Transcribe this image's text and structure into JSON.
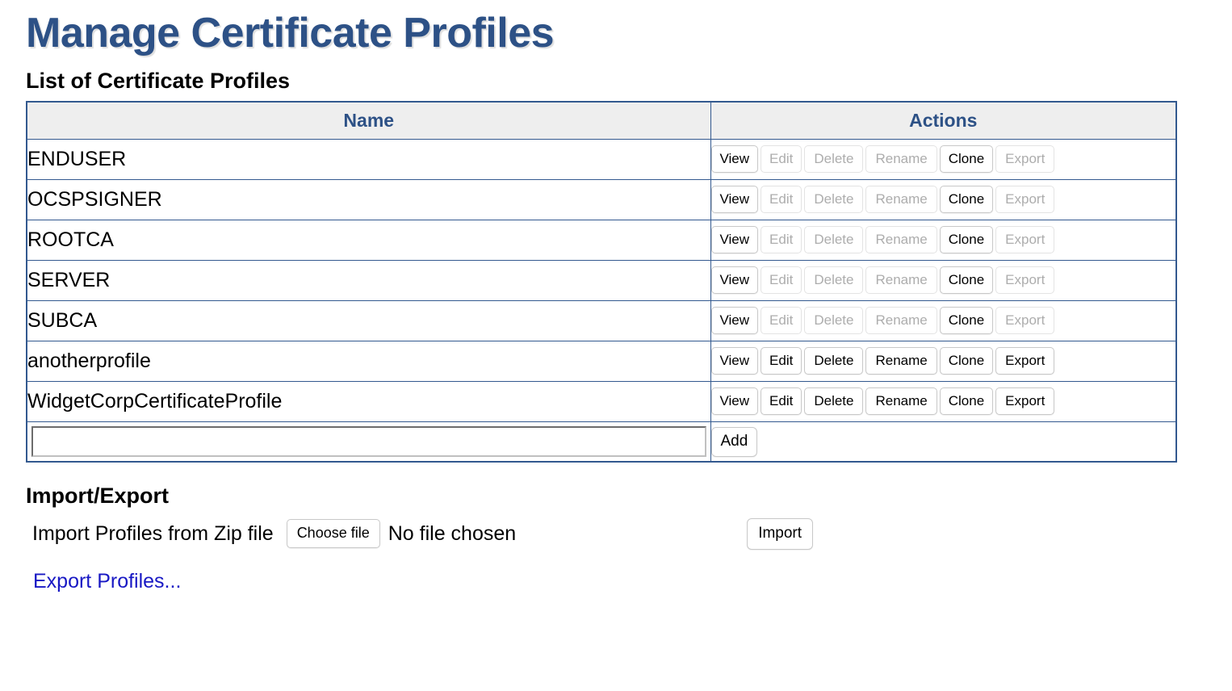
{
  "page": {
    "title": "Manage Certificate Profiles"
  },
  "profiles_section": {
    "heading": "List of Certificate Profiles",
    "columns": {
      "name": "Name",
      "actions": "Actions"
    },
    "action_labels": {
      "view": "View",
      "edit": "Edit",
      "delete": "Delete",
      "rename": "Rename",
      "clone": "Clone",
      "export": "Export"
    },
    "rows": [
      {
        "name": "ENDUSER",
        "actions": {
          "view": "View",
          "view_enabled": true,
          "edit": "Edit",
          "edit_enabled": false,
          "delete": "Delete",
          "delete_enabled": false,
          "rename": "Rename",
          "rename_enabled": false,
          "clone": "Clone",
          "clone_enabled": true,
          "export": "Export",
          "export_enabled": false
        }
      },
      {
        "name": "OCSPSIGNER",
        "actions": {
          "view": "View",
          "view_enabled": true,
          "edit": "Edit",
          "edit_enabled": false,
          "delete": "Delete",
          "delete_enabled": false,
          "rename": "Rename",
          "rename_enabled": false,
          "clone": "Clone",
          "clone_enabled": true,
          "export": "Export",
          "export_enabled": false
        }
      },
      {
        "name": "ROOTCA",
        "actions": {
          "view": "View",
          "view_enabled": true,
          "edit": "Edit",
          "edit_enabled": false,
          "delete": "Delete",
          "delete_enabled": false,
          "rename": "Rename",
          "rename_enabled": false,
          "clone": "Clone",
          "clone_enabled": true,
          "export": "Export",
          "export_enabled": false
        }
      },
      {
        "name": "SERVER",
        "actions": {
          "view": "View",
          "view_enabled": true,
          "edit": "Edit",
          "edit_enabled": false,
          "delete": "Delete",
          "delete_enabled": false,
          "rename": "Rename",
          "rename_enabled": false,
          "clone": "Clone",
          "clone_enabled": true,
          "export": "Export",
          "export_enabled": false
        }
      },
      {
        "name": "SUBCA",
        "actions": {
          "view": "View",
          "view_enabled": true,
          "edit": "Edit",
          "edit_enabled": false,
          "delete": "Delete",
          "delete_enabled": false,
          "rename": "Rename",
          "rename_enabled": false,
          "clone": "Clone",
          "clone_enabled": true,
          "export": "Export",
          "export_enabled": false
        }
      },
      {
        "name": "anotherprofile",
        "actions": {
          "view": "View",
          "view_enabled": true,
          "edit": "Edit",
          "edit_enabled": true,
          "delete": "Delete",
          "delete_enabled": true,
          "rename": "Rename",
          "rename_enabled": true,
          "clone": "Clone",
          "clone_enabled": true,
          "export": "Export",
          "export_enabled": true
        }
      },
      {
        "name": "WidgetCorpCertificateProfile",
        "actions": {
          "view": "View",
          "view_enabled": true,
          "edit": "Edit",
          "edit_enabled": true,
          "delete": "Delete",
          "delete_enabled": true,
          "rename": "Rename",
          "rename_enabled": true,
          "clone": "Clone",
          "clone_enabled": true,
          "export": "Export",
          "export_enabled": true
        }
      }
    ],
    "add_row": {
      "input_value": "",
      "input_placeholder": "",
      "add_label": "Add"
    }
  },
  "import_export_section": {
    "heading": "Import/Export",
    "import_label": "Import Profiles from Zip file",
    "choose_file_label": "Choose file",
    "no_file_text": "No file chosen",
    "import_button_label": "Import",
    "export_link_label": "Export Profiles..."
  },
  "colors": {
    "title_blue": "#2d5186",
    "table_border_blue": "#33598f",
    "header_bg_gray": "#eeeeee",
    "link_blue": "#1818c4",
    "disabled_gray": "#adadad"
  }
}
